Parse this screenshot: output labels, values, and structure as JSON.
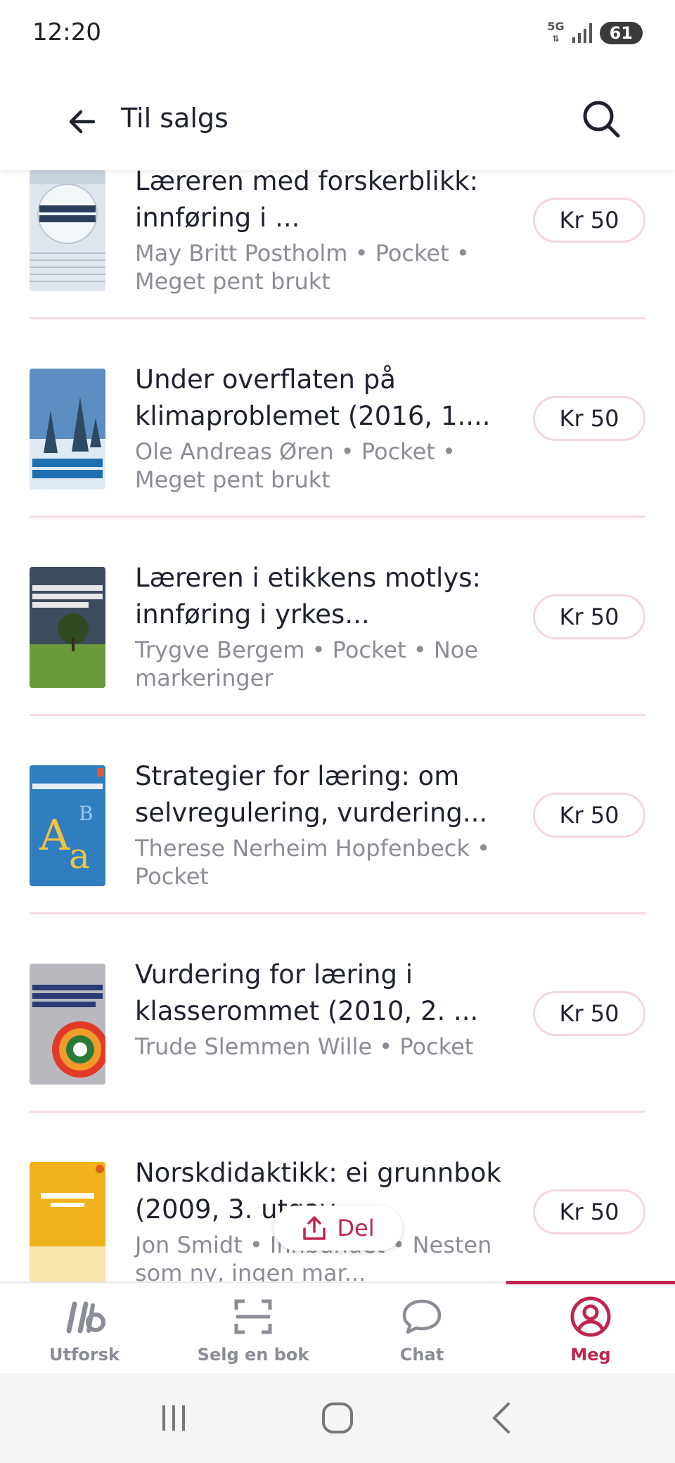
{
  "status_bar": {
    "time": "12:20",
    "network": "5G",
    "battery": "61"
  },
  "header": {
    "title": "Til salgs",
    "back_icon": "arrow-left-icon",
    "search_icon": "search-icon"
  },
  "books": [
    {
      "title": "Læreren med forskerblikk: innføring i ...",
      "meta": "May Britt Postholm • Pocket • Meget pent brukt",
      "price": "Kr 50"
    },
    {
      "title": "Under overflaten på klimaproblemet (2016, 1....",
      "meta": "Ole Andreas Øren • Pocket • Meget pent brukt",
      "price": "Kr 50"
    },
    {
      "title": "Læreren i etikkens motlys: innføring i yrkes...",
      "meta": "Trygve Bergem • Pocket • Noe markeringer",
      "price": "Kr 50"
    },
    {
      "title": "Strategier for læring: om selvregulering, vurdering...",
      "meta": "Therese Nerheim Hopfenbeck • Pocket",
      "price": "Kr 50"
    },
    {
      "title": "Vurdering for læring i klasserommet (2010, 2. ...",
      "meta": "Trude Slemmen Wille • Pocket",
      "price": "Kr 50"
    },
    {
      "title": "Norskdidaktikk: ei grunnbok (2009, 3. utgav...",
      "meta": "Jon Smidt • Innbundet • Nesten som ny, ingen mar...",
      "price": "Kr 50"
    }
  ],
  "share": {
    "label": "Del",
    "icon": "share-icon"
  },
  "bottom_nav": [
    {
      "label": "Utforsk",
      "icon": "logo-icon"
    },
    {
      "label": "Selg en bok",
      "icon": "scan-icon"
    },
    {
      "label": "Chat",
      "icon": "chat-icon"
    },
    {
      "label": "Meg",
      "icon": "profile-icon",
      "active": true
    }
  ],
  "colors": {
    "accent": "#c0264d",
    "divider": "#f7dce2",
    "meta_text": "#8a8d96"
  }
}
